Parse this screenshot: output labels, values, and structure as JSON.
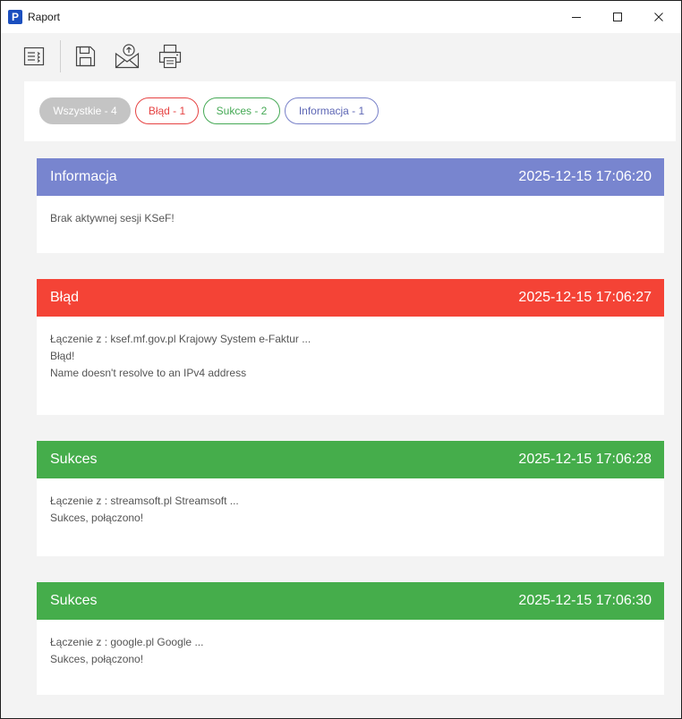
{
  "window": {
    "title": "Raport",
    "app_icon_letter": "P"
  },
  "toolbar": {
    "buttons": [
      {
        "icon": "list-icon"
      },
      {
        "icon": "save-icon"
      },
      {
        "icon": "email-send-icon"
      },
      {
        "icon": "print-icon"
      }
    ]
  },
  "filters": {
    "all": "Wszystkie - 4",
    "error": "Błąd - 1",
    "success": "Sukces - 2",
    "info": "Informacja - 1"
  },
  "colors": {
    "info": "#7885cf",
    "error": "#f44336",
    "success": "#45ad4b",
    "all_pill": "#c4c4c4"
  },
  "entries": [
    {
      "type": "Informacja",
      "timestamp": "2025-12-15 17:06:20",
      "lines": [
        "Brak aktywnej sesji KSeF!"
      ]
    },
    {
      "type": "Błąd",
      "timestamp": "2025-12-15 17:06:27",
      "lines": [
        "Łączenie z : ksef.mf.gov.pl Krajowy System e-Faktur ...",
        "Błąd!",
        "Name doesn't resolve to an IPv4 address"
      ]
    },
    {
      "type": "Sukces",
      "timestamp": "2025-12-15 17:06:28",
      "lines": [
        "Łączenie z : streamsoft.pl Streamsoft ...",
        "Sukces, połączono!"
      ]
    },
    {
      "type": "Sukces",
      "timestamp": "2025-12-15 17:06:30",
      "lines": [
        "Łączenie z : google.pl Google ...",
        "Sukces, połączono!"
      ]
    }
  ]
}
